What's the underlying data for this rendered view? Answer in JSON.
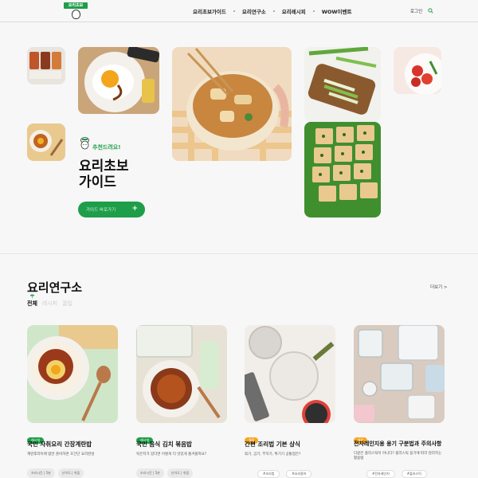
{
  "header": {
    "logo_text": "요리초보",
    "nav": [
      "요리초보가이드",
      "요리연구소",
      "요리레시피",
      "WOW이벤트"
    ],
    "login": "로그인"
  },
  "hero": {
    "tag": "추천드려요!",
    "title_line1": "요리초보",
    "title_line2": "가이드",
    "button_label": "가이드 바로가기",
    "button_icon": "+"
  },
  "research": {
    "title": "요리연구소",
    "more": "더보기 >",
    "tabs": [
      "전체",
      "레시피",
      "꿀팁"
    ]
  },
  "cards": [
    {
      "tag": "레시피",
      "tag_color": "#1f9e4a",
      "title": "국민 자취요리 간장계란밥",
      "desc": "계란후라이에 밥만 준비하면 초간단 요리완성",
      "meta": [
        [
          "조리시간",
          "5분"
        ],
        [
          "난이도",
          "쉬움"
        ]
      ]
    },
    {
      "tag": "레시피",
      "tag_color": "#1f9e4a",
      "title": "국민 음식 김치 볶음밥",
      "desc": "묵은지가 있다면 이렇게 더 맛있게 즐겨볼까요?",
      "meta": [
        [
          "조리시간",
          "5분"
        ],
        [
          "난이도",
          "쉬움"
        ]
      ]
    },
    {
      "tag": "꿀팁",
      "tag_color": "#f5a623",
      "title": "간편 조리법 기본 상식",
      "desc": "볶기, 굽기, 부치기, 튀기기 공통점은?",
      "hashtags": [
        "#조리법",
        "#요리용어"
      ]
    },
    {
      "tag": "꿀팁",
      "tag_color": "#f5a623",
      "title": "전자레인지용 용기 구분법과 주의사항",
      "desc": "다같은 플라스틱이 아니다? 플라스틱 용기에 따라 달라지는 활용법",
      "hashtags": [
        "#전자레인지",
        "#플라스틱"
      ]
    }
  ],
  "colors": {
    "brand": "#1f9e4a",
    "tip": "#f5a623"
  }
}
